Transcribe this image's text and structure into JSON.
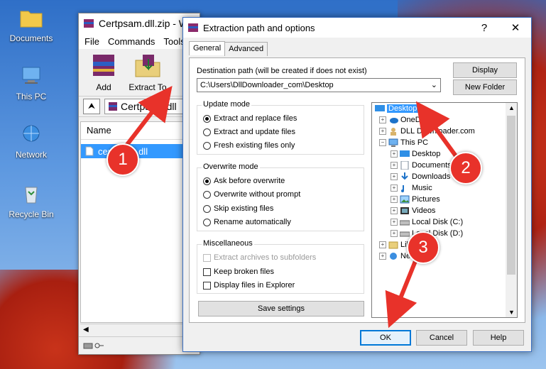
{
  "desktop": {
    "icons": [
      {
        "label": "Documents",
        "icon": "folder-icon"
      },
      {
        "label": "This PC",
        "icon": "computer-icon"
      },
      {
        "label": "Network",
        "icon": "network-icon"
      },
      {
        "label": "Recycle Bin",
        "icon": "recycle-bin-icon"
      }
    ]
  },
  "winrar": {
    "title": "Certpsam.dll.zip - W",
    "menu": [
      "File",
      "Commands",
      "Tools"
    ],
    "toolbar": [
      {
        "label": "Add",
        "icon": "add-archive-icon"
      },
      {
        "label": "Extract To",
        "icon": "extract-to-icon"
      }
    ],
    "address": "Certpsam.dll",
    "column_name": "Name",
    "selected_file": "certpsam.dll"
  },
  "dialog": {
    "title": "Extraction path and options",
    "help_glyph": "?",
    "close_glyph": "✕",
    "tabs": [
      "General",
      "Advanced"
    ],
    "destination_label": "Destination path (will be created if does not exist)",
    "destination_value": "C:\\Users\\DllDownloader_com\\Desktop",
    "display_button": "Display",
    "new_folder_button": "New Folder",
    "update_mode": {
      "title": "Update mode",
      "options": [
        "Extract and replace files",
        "Extract and update files",
        "Fresh existing files only"
      ],
      "selected": 0
    },
    "overwrite_mode": {
      "title": "Overwrite mode",
      "options": [
        "Ask before overwrite",
        "Overwrite without prompt",
        "Skip existing files",
        "Rename automatically"
      ],
      "selected": 0
    },
    "misc": {
      "title": "Miscellaneous",
      "options": [
        {
          "label": "Extract archives to subfolders",
          "disabled": true
        },
        {
          "label": "Keep broken files",
          "disabled": false
        },
        {
          "label": "Display files in Explorer",
          "disabled": false
        }
      ]
    },
    "save_settings": "Save settings",
    "tree": [
      {
        "label": "Desktop",
        "icon": "desktop-icon",
        "selected": true
      },
      {
        "label": "OneDrive",
        "icon": "onedrive-icon"
      },
      {
        "label": "DLL Downloader.com",
        "icon": "user-icon"
      },
      {
        "label": "This PC",
        "icon": "computer-icon"
      },
      {
        "label": "Desktop",
        "icon": "desktop-icon"
      },
      {
        "label": "Documents",
        "icon": "documents-icon"
      },
      {
        "label": "Downloads",
        "icon": "downloads-icon"
      },
      {
        "label": "Music",
        "icon": "music-icon"
      },
      {
        "label": "Pictures",
        "icon": "pictures-icon"
      },
      {
        "label": "Videos",
        "icon": "videos-icon"
      },
      {
        "label": "Local Disk (C:)",
        "icon": "drive-icon"
      },
      {
        "label": "Local Disk (D:)",
        "icon": "drive-icon"
      },
      {
        "label": "Libraries",
        "icon": "libraries-icon"
      },
      {
        "label": "Network",
        "icon": "network-icon"
      }
    ],
    "ok": "OK",
    "cancel": "Cancel",
    "help": "Help"
  },
  "annotations": {
    "steps": [
      "1",
      "2",
      "3"
    ],
    "color": "#e8322a"
  }
}
